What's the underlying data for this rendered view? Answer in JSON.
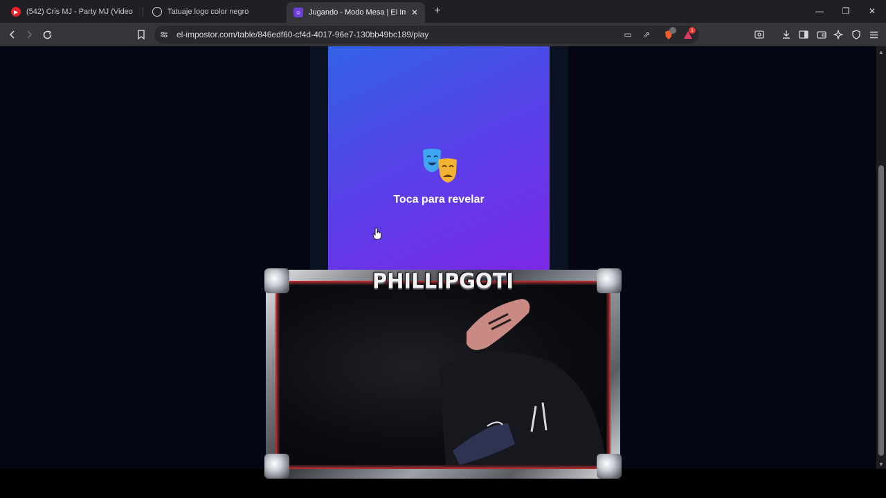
{
  "tabs": [
    {
      "title": "(542) Cris MJ - Party MJ (Video Oficial",
      "icon": "youtube-icon",
      "active": false
    },
    {
      "title": "Tatuaje logo color negro",
      "icon": "chatgpt-icon",
      "active": false
    },
    {
      "title": "Jugando - Modo Mesa | El Impostor",
      "icon": "theater-masks-icon",
      "active": true
    }
  ],
  "toolbar": {
    "url": "el-impostor.com/table/846edf60-cf4d-4017-96e7-130bb49bc189/play",
    "brave_badge": "",
    "rewards_badge": "1"
  },
  "page": {
    "reveal_label": "Toca para revelar",
    "card_gradient": [
      "#3162e6",
      "#7e26e6"
    ]
  },
  "overlay": {
    "streamer_name": "PHILLIPGOTI"
  },
  "colors": {
    "page_bg": "#040713",
    "column_bg": "#0b1221",
    "accent_red": "#b02a2a"
  }
}
